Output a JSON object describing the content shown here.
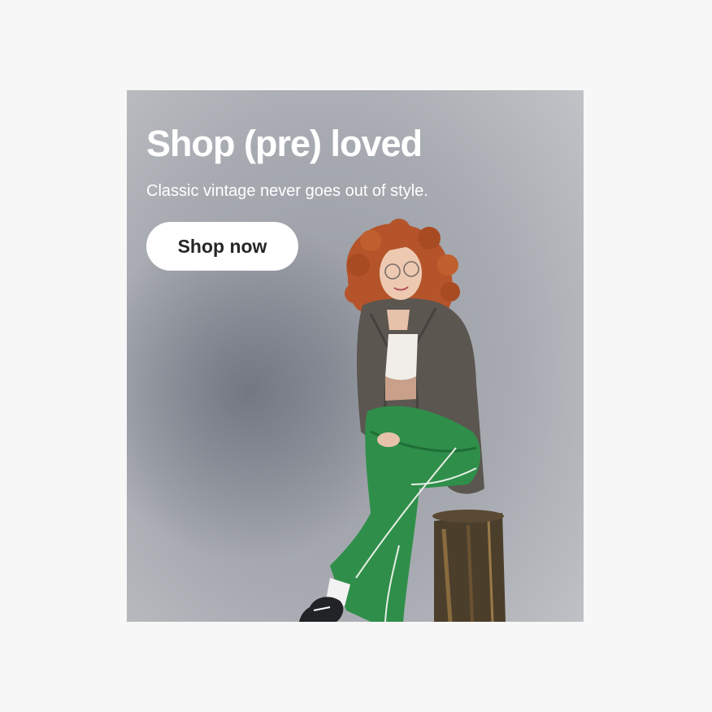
{
  "banner": {
    "headline": "Shop (pre) loved",
    "subheadline": "Classic vintage never goes out of style.",
    "cta_label": "Shop now",
    "image_subject": "model-photo",
    "colors": {
      "page_background": "#f7f7f7",
      "banner_background": "#a7aab1",
      "text": "#ffffff",
      "button_background": "#ffffff",
      "button_text": "#262626"
    }
  }
}
